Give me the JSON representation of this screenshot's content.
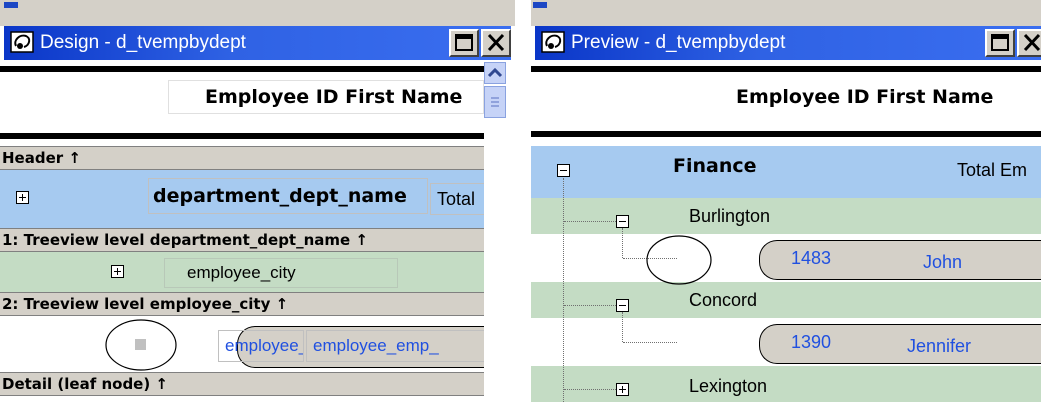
{
  "design_window": {
    "title": "Design - d_tvempbydept",
    "column_header": "Employee ID First Name",
    "bands": {
      "header": "Header ↑",
      "level1": "1: Treeview level department_dept_name ↑",
      "level2": "2: Treeview level employee_city ↑",
      "detail": "Detail (leaf node) ↑"
    },
    "dept_field": "department_dept_name",
    "total_text": "Total",
    "city_field": "employee_city",
    "detail_fields": [
      "employee_",
      "employee_emp_"
    ]
  },
  "preview_window": {
    "title": "Preview - d_tvempbydept",
    "column_header": "Employee ID First Name",
    "department": "Finance",
    "total_text": "Total Em",
    "cities": [
      "Burlington",
      "Concord",
      "Lexington"
    ],
    "employees": [
      {
        "id": "1483",
        "first_name": "John"
      },
      {
        "id": "1390",
        "first_name": "Jennifer"
      }
    ]
  },
  "colors": {
    "titlebar": "#2f62e4",
    "band_blue": "#a6caf0",
    "band_green": "#c4dcc4",
    "band_gray": "#d4d0c8",
    "link_blue": "#2050e0"
  },
  "icons": [
    "window-app-icon",
    "maximize-icon",
    "close-icon",
    "scroll-up-icon",
    "tree-expand-icon",
    "tree-collapse-icon"
  ]
}
